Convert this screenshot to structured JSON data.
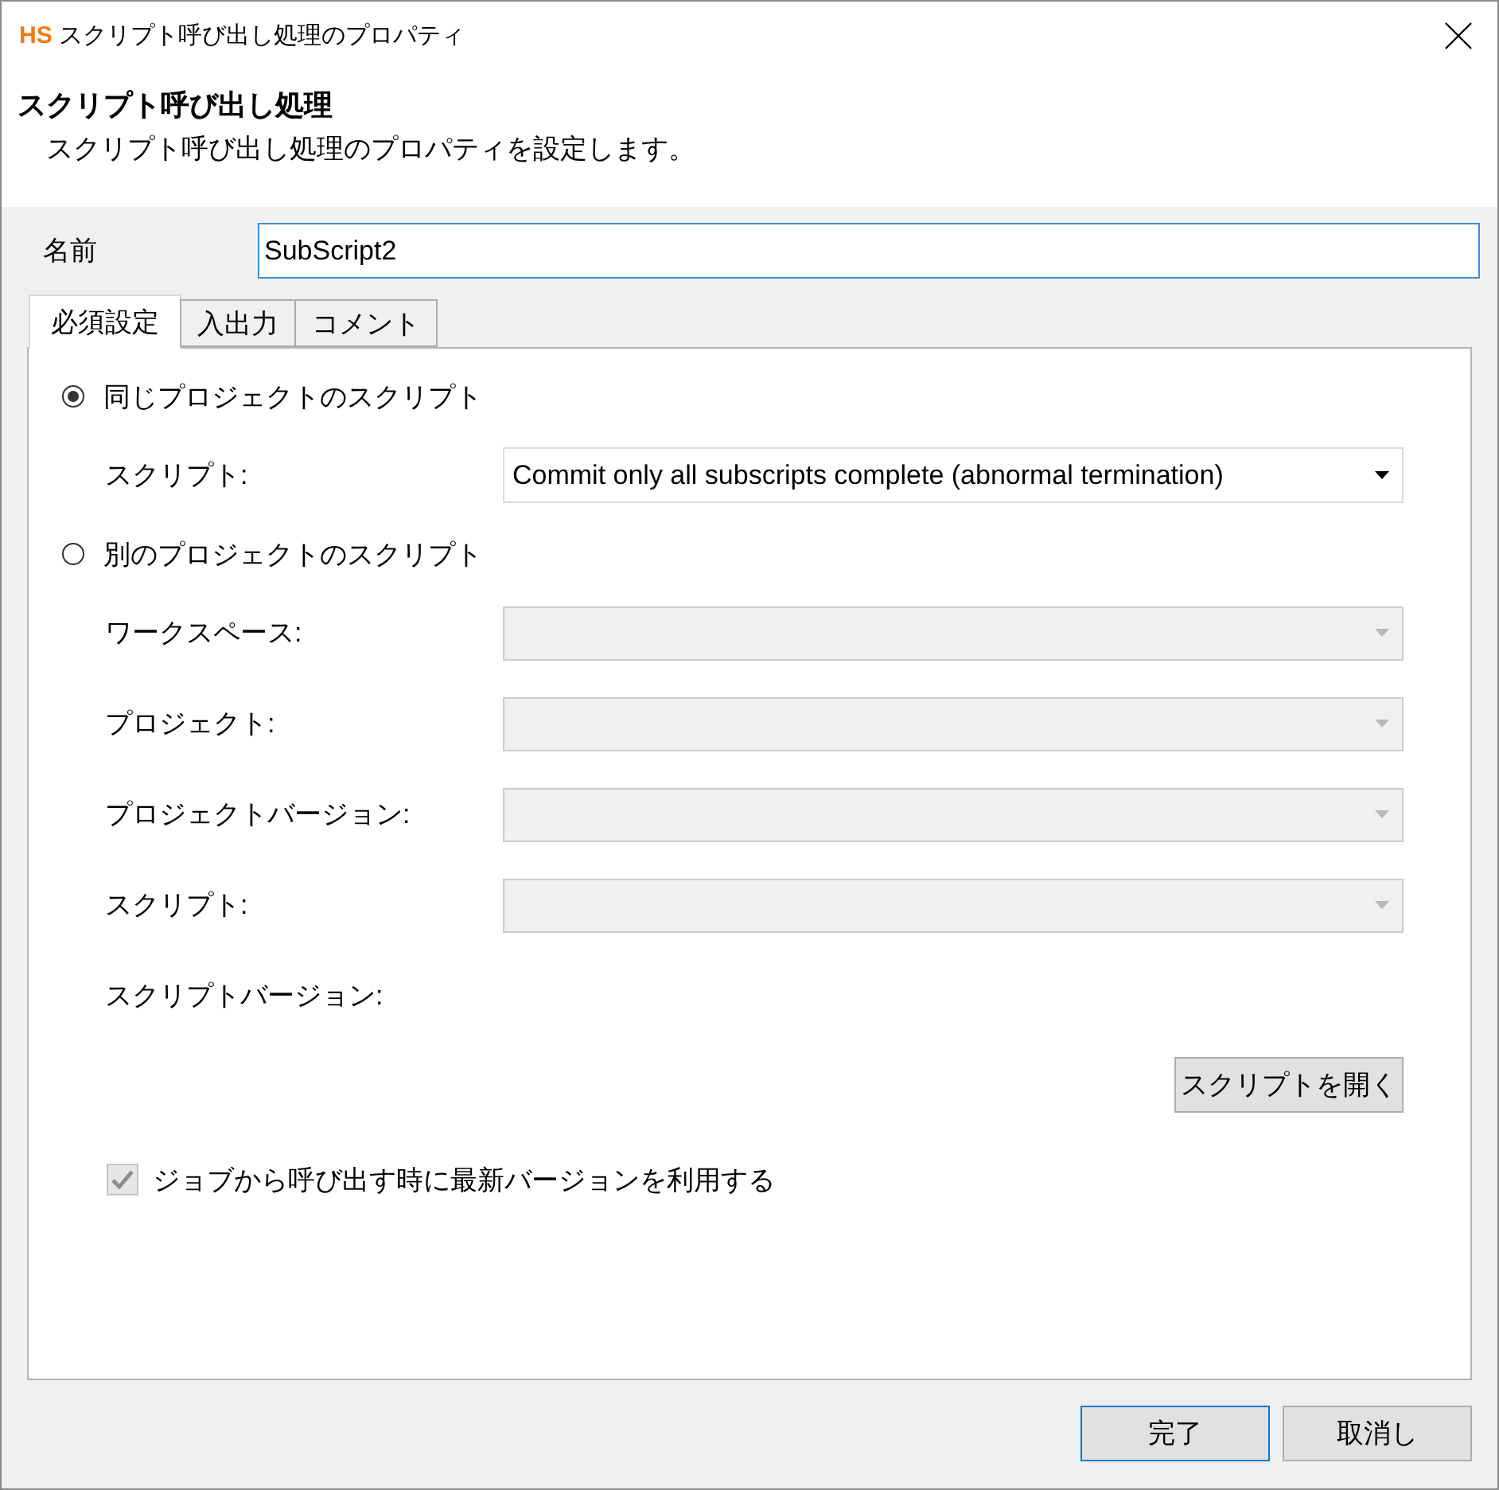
{
  "window": {
    "logo": "HS",
    "title": "スクリプト呼び出し処理のプロパティ"
  },
  "header": {
    "title": "スクリプト呼び出し処理",
    "description": "スクリプト呼び出し処理のプロパティを設定します。"
  },
  "name_field": {
    "label": "名前",
    "value": "SubScript2",
    "focused": true
  },
  "tabs": [
    {
      "label": "必須設定",
      "selected": true
    },
    {
      "label": "入出力",
      "selected": false
    },
    {
      "label": "コメント",
      "selected": false
    }
  ],
  "source_options": [
    {
      "label": "同じプロジェクトのスクリプト",
      "selected": true,
      "fields": [
        {
          "kind": "dropdown",
          "label": "スクリプト:",
          "value": "Commit only all subscripts complete (abnormal termination)",
          "disabled": false
        }
      ]
    },
    {
      "label": "別のプロジェクトのスクリプト",
      "selected": false,
      "fields": [
        {
          "kind": "dropdown",
          "label": "ワークスペース:",
          "disabled": true
        },
        {
          "kind": "dropdown",
          "label": "プロジェクト:",
          "disabled": true
        },
        {
          "kind": "dropdown",
          "label": "プロジェクトバージョン:",
          "disabled": true
        },
        {
          "kind": "dropdown",
          "label": "スクリプト:",
          "disabled": true
        },
        {
          "kind": "label",
          "label": "スクリプトバージョン:"
        }
      ]
    }
  ],
  "open_script_button": {
    "label": "スクリプトを開く"
  },
  "use_latest_checkbox": {
    "label": "ジョブから呼び出す時に最新バージョンを利用する",
    "checked": true,
    "disabled": true
  },
  "buttons": [
    {
      "label": "完了",
      "default": true
    },
    {
      "label": "取消し",
      "default": false
    }
  ]
}
